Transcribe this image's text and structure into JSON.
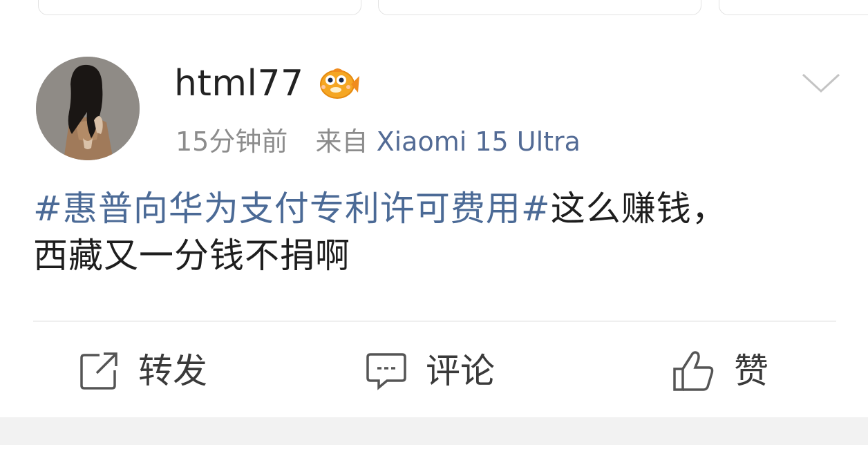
{
  "post": {
    "username": "html77",
    "badge_icon": "fish-vip-badge-icon",
    "time": "15分钟前",
    "source_prefix": "来自",
    "device": "Xiaomi 15 Ultra",
    "hashtag": "#惠普向华为支付专利许可费用#",
    "body_text_1": "这么赚钱，",
    "body_text_2": "西藏又一分钱不捐啊"
  },
  "actions": {
    "repost_label": "转发",
    "comment_label": "评论",
    "like_label": "赞"
  },
  "colors": {
    "link": "#4b6a96",
    "meta_gray": "#8c8c8c",
    "text": "#1e1e1e"
  }
}
